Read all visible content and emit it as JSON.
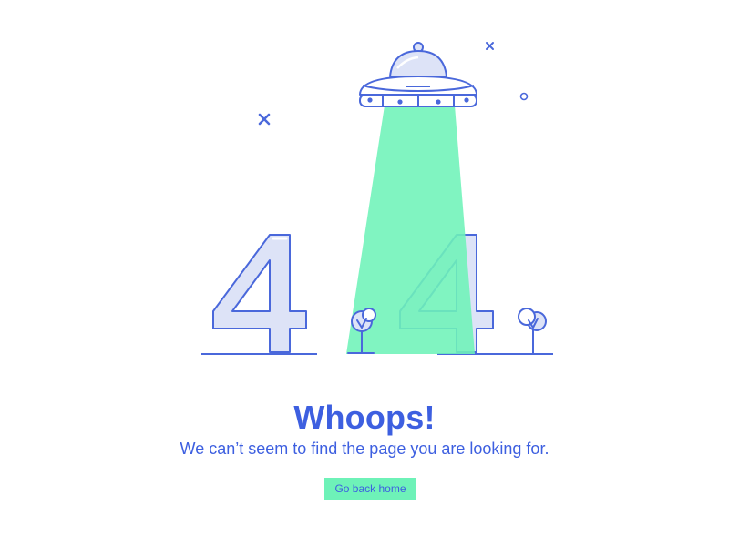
{
  "error_code": "404",
  "heading": "Whoops!",
  "subtitle": "We can’t seem to find the page you are looking for.",
  "button": {
    "label": "Go back home"
  },
  "colors": {
    "primary_blue": "#3d5fe0",
    "stroke_blue": "#4a68db",
    "fill_lavender": "#dde3f7",
    "beam_green": "#6ef2b8",
    "button_green": "#6ef2b8",
    "background": "#ffffff"
  },
  "icons": [
    "ufo-icon",
    "star-x-icon",
    "star-circle-icon",
    "tree-icon"
  ]
}
